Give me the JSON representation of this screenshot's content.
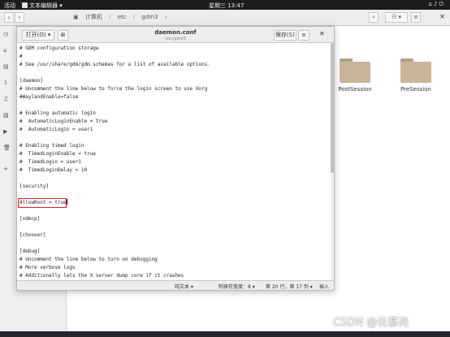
{
  "topbar": {
    "activities": "活动",
    "app_name": "文本编辑器",
    "clock": "星期三 13:47",
    "tray_icons": [
      "network-icon",
      "volume-icon",
      "power-icon"
    ]
  },
  "files": {
    "path": [
      "计算机",
      "etc",
      "gdm3"
    ],
    "folders": [
      "PostSession",
      "PreSession"
    ]
  },
  "gedit": {
    "open_label": "打开(O)",
    "title": "daemon.conf",
    "path": "/etc/gdm3",
    "save_label": "保存(S)",
    "lines": [
      "# GDM configuration storage",
      "#",
      "# See /usr/share/gdm/gdm.schemas for a list of available options.",
      "",
      "[daemon]",
      "# Uncomment the line below to force the login screen to use Xorg",
      "#WaylandEnable=false",
      "",
      "# Enabling automatic login",
      "#  AutomaticLoginEnable = true",
      "#  AutomaticLogin = user1",
      "",
      "# Enabling timed login",
      "#  TimedLoginEnable = true",
      "#  TimedLogin = user1",
      "#  TimedLoginDelay = 10",
      "",
      "[security]",
      "",
      "AllowRoot = true",
      "",
      "[xdmcp]",
      "",
      "[chooser]",
      "",
      "[debug]",
      "# Uncomment the line below to turn on debugging",
      "# More verbose logs",
      "# Additionally lets the X server dump core if it crashes"
    ],
    "status": {
      "language": "纯文本 ▾",
      "tab_width": "制表符宽度：8 ▾",
      "position": "第 20 行，第 17 列 ▾",
      "mode": "插入"
    }
  },
  "watermark": "CSDN @云慕尧"
}
